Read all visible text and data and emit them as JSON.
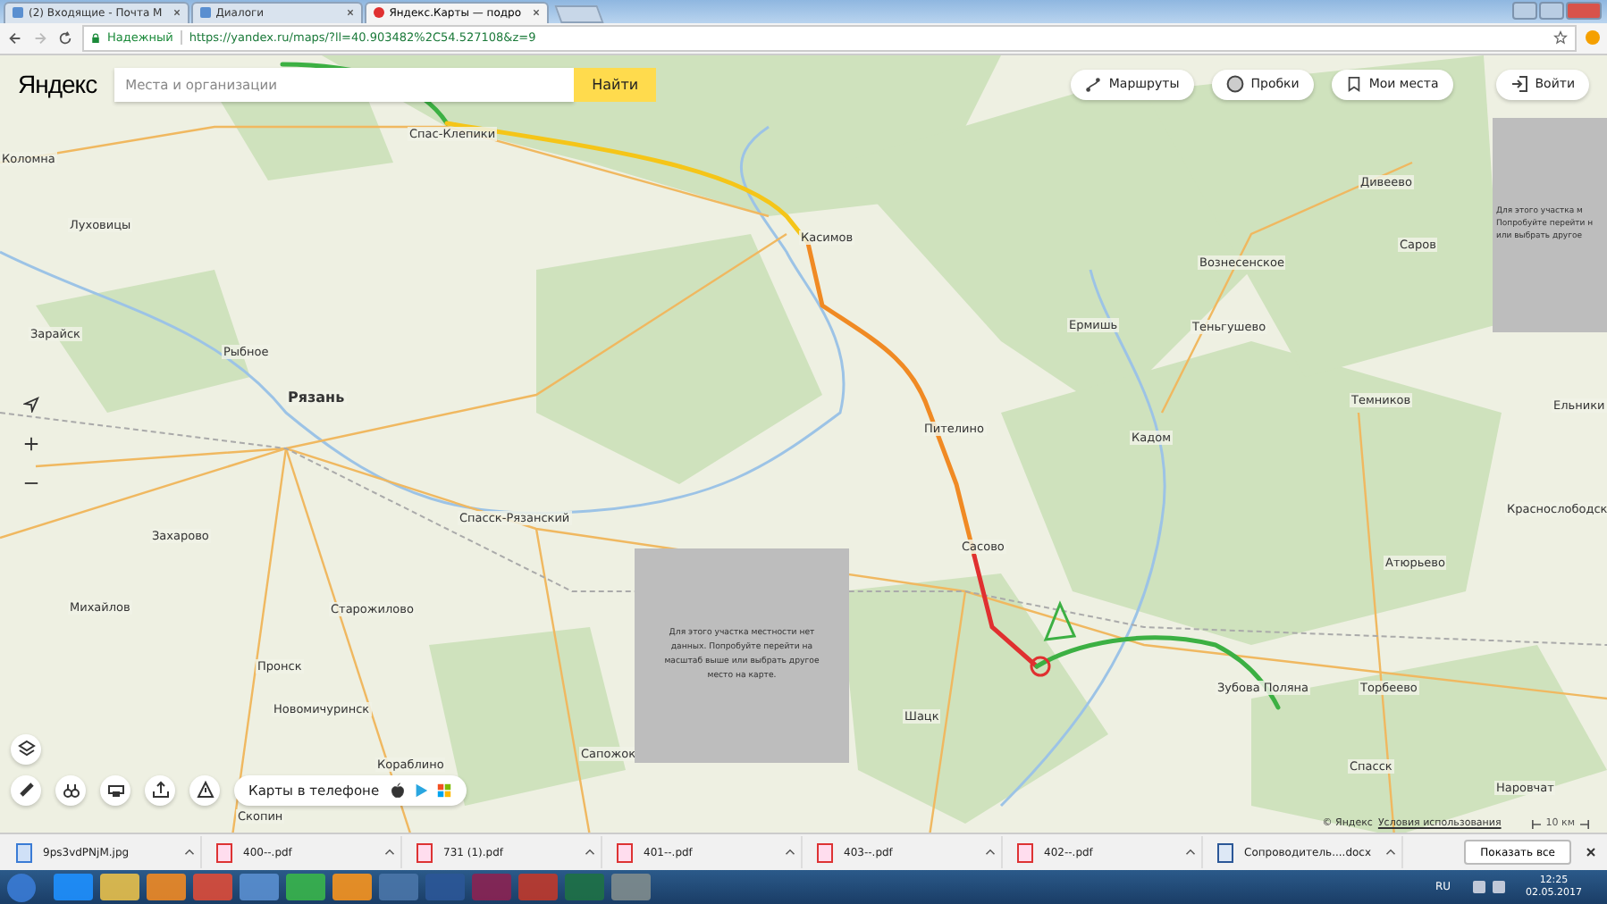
{
  "browser": {
    "tabs": [
      {
        "title": "(2) Входящие - Почта М",
        "selected": false
      },
      {
        "title": "Диалоги",
        "selected": false
      },
      {
        "title": "Яндекс.Карты — подро",
        "selected": true
      }
    ],
    "secure_label": "Надежный",
    "url": "https://yandex.ru/maps/?ll=40.903482%2C54.527108&z=9"
  },
  "map": {
    "logo": "Яндекс",
    "search": {
      "placeholder": "Места и организации"
    },
    "search_button": "Найти",
    "top_buttons": [
      "Маршруты",
      "Пробки",
      "Мои места",
      "Войти"
    ],
    "places": [
      "Коломна",
      "Луховицы",
      "Зарайск",
      "Рыбное",
      "Рязань",
      "Спас-Клепики",
      "Касимов",
      "Захарово",
      "Спасск-Рязанский",
      "Михайлов",
      "Старожилово",
      "Пронск",
      "Новомичуринск",
      "Кораблино",
      "Скопин",
      "Сапожок",
      "Шацк",
      "Сасово",
      "Пителино",
      "Кадом",
      "Ермишь",
      "Вознесенское",
      "Теньгушево",
      "Дивеево",
      "Саров",
      "Темников",
      "Ельники",
      "Краснослободск",
      "Атюрьево",
      "Торбеево",
      "Зубова Поляна",
      "Спасск",
      "Наровчат"
    ],
    "no_data_main": "Для этого участка местности нет данных. Попробуйте перейти на масштаб выше или выбрать другое место на карте.",
    "no_data_side": [
      "Для этого участка м",
      "Попробуйте перейти н",
      "или выбрать другое"
    ],
    "phone_promo": "Карты в телефоне",
    "copyright": "© Яндекс",
    "terms_link": "Условия использования",
    "scale": "10 км"
  },
  "downloads": {
    "items": [
      {
        "name": "9ps3vdPNjM.jpg",
        "kind": "image"
      },
      {
        "name": "400--.pdf",
        "kind": "pdf"
      },
      {
        "name": "731 (1).pdf",
        "kind": "pdf"
      },
      {
        "name": "401--.pdf",
        "kind": "pdf"
      },
      {
        "name": "403--.pdf",
        "kind": "pdf"
      },
      {
        "name": "402--.pdf",
        "kind": "pdf"
      },
      {
        "name": "Сопроводитель....docx",
        "kind": "doc"
      }
    ],
    "show_all": "Показать все"
  },
  "taskbar": {
    "language": "RU",
    "time": "12:25",
    "date": "02.05.2017"
  }
}
